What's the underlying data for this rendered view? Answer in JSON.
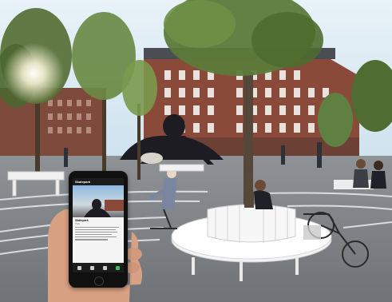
{
  "image": {
    "description_colors": {
      "sky": "#d9ebf5",
      "brick": "#8a4a3a",
      "bench": "#f2f2f2",
      "pavement": "#9a9da0",
      "foliage": "#5d7a3a",
      "octopus_sculpture": "#1c1c22"
    }
  },
  "phone": {
    "screen_title": "Skatepark",
    "heading": "Skatepark",
    "subtitle": "Park",
    "tabs": [
      "tab-1",
      "tab-2",
      "tab-3",
      "tab-4"
    ]
  }
}
